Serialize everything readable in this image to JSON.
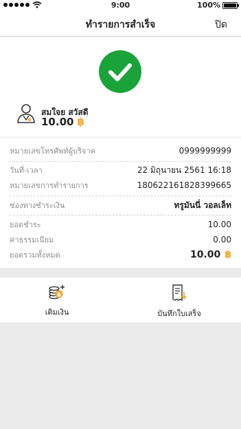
{
  "status_bar": {
    "time": "9:00",
    "battery": "100%",
    "battery_level": 1.0
  },
  "nav": {
    "title": "ทำรายการสำเร็จ",
    "close_label": "ปิด"
  },
  "success_icon": {
    "name": "checkmark-icon",
    "color": "#1aa33a"
  },
  "recipient": {
    "name": "สมใจย สวัสดี",
    "amount": "10.00",
    "currency_symbol": "฿",
    "icon": "user-icon"
  },
  "details": [
    {
      "label": "หมายเลขโทรศัพท์ผู้บริจาค",
      "value": "0999999999"
    },
    {
      "label": "วันที่-เวลา",
      "value": "22 มิถุนายน 2561 16:18"
    },
    {
      "label": "หมายเลขการทำรายการ",
      "value": "180622161828399665"
    },
    {
      "label": "ช่องทางชำระเงิน",
      "value": "ทรูมันนี่ วอลเล็ท"
    }
  ],
  "summary": [
    {
      "label": "ยอดชำระ",
      "value": "10.00"
    },
    {
      "label": "ค่าธรรมเนียม",
      "value": "0.00"
    },
    {
      "label": "ยอดรวมทั้งหมด",
      "value": "10.00",
      "currency_symbol": "฿"
    }
  ],
  "actions": [
    {
      "label": "เติมเงิน",
      "icon": "topup-coins-icon"
    },
    {
      "label": "บันทึกใบเสร็จ",
      "icon": "save-receipt-icon"
    }
  ],
  "colors": {
    "accent": "#1aa33a",
    "currency": "#f5a623"
  }
}
